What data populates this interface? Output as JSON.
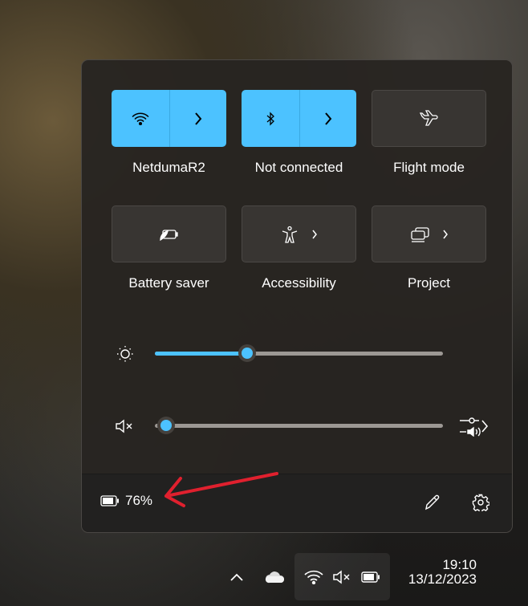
{
  "quick_settings": {
    "tiles": [
      {
        "label": "NetdumaR2",
        "icon": "wifi-icon",
        "active": true,
        "has_chevron": true
      },
      {
        "label": "Not connected",
        "icon": "bluetooth-icon",
        "active": true,
        "has_chevron": true
      },
      {
        "label": "Flight mode",
        "icon": "airplane-icon",
        "active": false
      },
      {
        "label": "Battery saver",
        "icon": "battery-saver-icon",
        "active": false
      },
      {
        "label": "Accessibility",
        "icon": "accessibility-icon",
        "active": false,
        "has_chevron": true
      },
      {
        "label": "Project",
        "icon": "project-icon",
        "active": false,
        "has_chevron": true
      }
    ],
    "brightness": {
      "icon": "brightness-icon",
      "percent": 32
    },
    "volume": {
      "icon": "volume-muted-icon",
      "percent": 0,
      "muted": true
    },
    "footer": {
      "battery_percent": "76%",
      "edit_icon": "pencil-icon",
      "settings_icon": "gear-icon"
    }
  },
  "taskbar": {
    "time": "19:10",
    "date": "13/12/2023"
  },
  "colors": {
    "accent": "#4cc2ff",
    "annotation_arrow": "#e0202e"
  }
}
